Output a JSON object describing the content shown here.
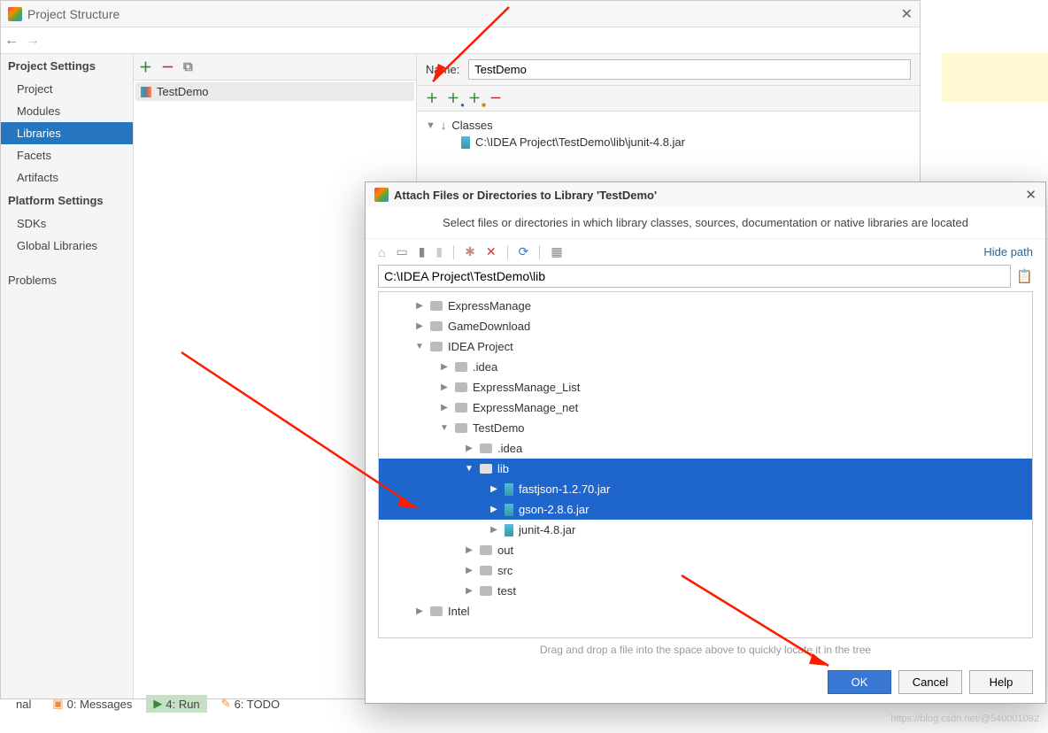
{
  "main": {
    "title": "Project Structure",
    "library_name": "TestDemo",
    "name_label": "Name:",
    "classes_label": "Classes",
    "classes_file": "C:\\IDEA Project\\TestDemo\\lib\\junit-4.8.jar",
    "center_item": "TestDemo"
  },
  "sidebar": {
    "section1": "Project Settings",
    "items1": [
      "Project",
      "Modules",
      "Libraries",
      "Facets",
      "Artifacts"
    ],
    "section2": "Platform Settings",
    "items2": [
      "SDKs",
      "Global Libraries"
    ],
    "section3": "",
    "items3": [
      "Problems"
    ]
  },
  "dialog": {
    "title": "Attach Files or Directories to Library 'TestDemo'",
    "instruction": "Select files or directories in which library classes, sources, documentation or native libraries are located",
    "hide_path": "Hide path",
    "path": "C:\\IDEA Project\\TestDemo\\lib",
    "drag_hint": "Drag and drop a file into the space above to quickly locate it in the tree",
    "ok": "OK",
    "cancel": "Cancel",
    "help": "Help",
    "tree": [
      {
        "depth": 0,
        "tri": "▶",
        "icon": "folder",
        "label": "ExpressManage",
        "sel": false
      },
      {
        "depth": 0,
        "tri": "▶",
        "icon": "folder",
        "label": "GameDownload",
        "sel": false
      },
      {
        "depth": 0,
        "tri": "▼",
        "icon": "folder",
        "label": "IDEA Project",
        "sel": false
      },
      {
        "depth": 1,
        "tri": "▶",
        "icon": "folder",
        "label": ".idea",
        "sel": false
      },
      {
        "depth": 1,
        "tri": "▶",
        "icon": "folder",
        "label": "ExpressManage_List",
        "sel": false
      },
      {
        "depth": 1,
        "tri": "▶",
        "icon": "folder",
        "label": "ExpressManage_net",
        "sel": false
      },
      {
        "depth": 1,
        "tri": "▼",
        "icon": "folder",
        "label": "TestDemo",
        "sel": false
      },
      {
        "depth": 2,
        "tri": "▶",
        "icon": "folder",
        "label": ".idea",
        "sel": false
      },
      {
        "depth": 2,
        "tri": "▼",
        "icon": "folder",
        "label": "lib",
        "sel": true
      },
      {
        "depth": 3,
        "tri": "▶",
        "icon": "jar",
        "label": "fastjson-1.2.70.jar",
        "sel": true
      },
      {
        "depth": 3,
        "tri": "▶",
        "icon": "jar",
        "label": "gson-2.8.6.jar",
        "sel": true
      },
      {
        "depth": 3,
        "tri": "▶",
        "icon": "jar",
        "label": "junit-4.8.jar",
        "sel": false
      },
      {
        "depth": 2,
        "tri": "▶",
        "icon": "folder",
        "label": "out",
        "sel": false
      },
      {
        "depth": 2,
        "tri": "▶",
        "icon": "folder",
        "label": "src",
        "sel": false
      },
      {
        "depth": 2,
        "tri": "▶",
        "icon": "folder",
        "label": "test",
        "sel": false
      },
      {
        "depth": 0,
        "tri": "▶",
        "icon": "folder",
        "label": "Intel",
        "sel": false
      }
    ]
  },
  "bottom": {
    "terminal": "nal",
    "messages": "0: Messages",
    "run": "4: Run",
    "todo": "6: TODO"
  },
  "watermark": "https://blog.csdn.net/@540001092"
}
